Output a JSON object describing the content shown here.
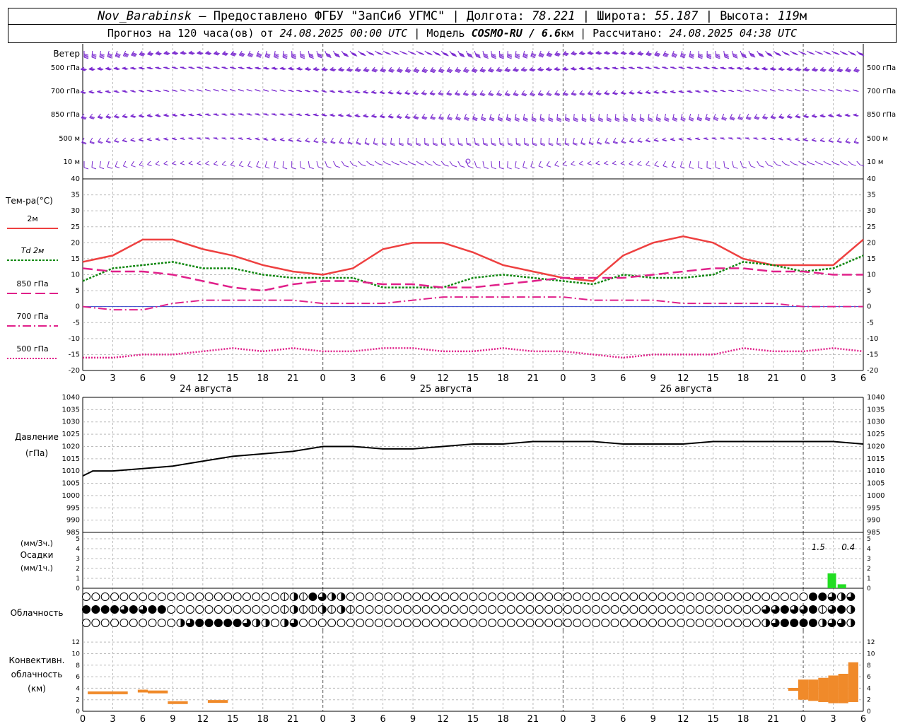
{
  "header": {
    "station": "Nov_Barabinsk",
    "provider": " — Предоставлено ФГБУ \"ЗапСиб УГМС\" | ",
    "lon_label": "Долгота: ",
    "lon": "78.221",
    "lat_label": " | Широта: ",
    "lat": "55.187",
    "alt_label": " | Высота: ",
    "alt": "119",
    "alt_unit": "м",
    "forecast_label": "Прогноз на 120 часа(ов) от ",
    "forecast_from": "24.08.2025 00:00 UTC",
    "model_label": " | Модель ",
    "model": "COSMO-RU / 6.6",
    "model_unit": "км",
    "computed_label": " | Рассчитано: ",
    "computed": "24.08.2025 04:38 UTC"
  },
  "axis": {
    "hour_ticks": [
      "0",
      "3",
      "6",
      "9",
      "12",
      "15",
      "18",
      "21",
      "0",
      "3",
      "6",
      "9",
      "12",
      "15",
      "18",
      "21",
      "0",
      "3",
      "6",
      "9",
      "12",
      "15",
      "18",
      "21",
      "0",
      "3",
      "6"
    ],
    "days": [
      "24 августа",
      "25 августа",
      "26 августа"
    ]
  },
  "wind": {
    "title": "Ветер",
    "levels": [
      "500 гПа",
      "700 гПа",
      "850 гПа",
      "500 м",
      "10  м"
    ]
  },
  "temperature": {
    "title": "Тем-ра(°С)",
    "legend": [
      {
        "label": "2м",
        "color": "#ee4040",
        "dash": "solid"
      },
      {
        "label": "Td 2м",
        "color": "#118811",
        "dash": "dot"
      },
      {
        "label": "850 гПа",
        "color": "#e0208a",
        "dash": "long"
      },
      {
        "label": "700 гПа",
        "color": "#e0208a",
        "dash": "dashdot"
      },
      {
        "label": "500 гПа",
        "color": "#e0208a",
        "dash": "fine"
      }
    ],
    "ticks": [
      "40",
      "35",
      "30",
      "25",
      "20",
      "15",
      "10",
      "5",
      "0",
      "-5",
      "-10",
      "-15",
      "-20"
    ]
  },
  "pressure": {
    "title": "Давление",
    "unit": "(гПа)",
    "ticks": [
      "1040",
      "1035",
      "1030",
      "1025",
      "1020",
      "1015",
      "1010",
      "1005",
      "1000",
      "995",
      "990",
      "985"
    ]
  },
  "precip": {
    "title": "Осадки",
    "unit3": "(мм/3ч.)",
    "unit1": "(мм/1ч.)",
    "ticks": [
      "5",
      "4",
      "3",
      "2",
      "1",
      "0"
    ],
    "labels": [
      "1.5",
      "0.4"
    ]
  },
  "clouds": {
    "title": "Облачность"
  },
  "convective": {
    "title1": "Конвективн.",
    "title2": "облачность",
    "unit": "(км)",
    "ticks": [
      "12",
      "10",
      "8",
      "6",
      "4",
      "2",
      "0"
    ]
  },
  "chart_data": [
    {
      "type": "line",
      "title": "Тем-ра(°С)",
      "x_unit": "hours from 24.08.2025 00:00 UTC",
      "x": [
        0,
        3,
        6,
        9,
        12,
        15,
        18,
        21,
        24,
        27,
        30,
        33,
        36,
        39,
        42,
        45,
        48,
        51,
        54,
        57,
        60,
        63,
        66,
        69,
        72,
        75,
        78
      ],
      "ylim": [
        -20,
        40
      ],
      "series": [
        {
          "name": "2м",
          "color": "#ee4040",
          "values": [
            14,
            16,
            21,
            21,
            18,
            16,
            13,
            11,
            10,
            12,
            18,
            20,
            20,
            17,
            13,
            11,
            9,
            8,
            16,
            20,
            22,
            20,
            15,
            13,
            13,
            13,
            21
          ]
        },
        {
          "name": "Td 2м",
          "color": "#118811",
          "values": [
            8,
            12,
            13,
            14,
            12,
            12,
            10,
            9,
            9,
            9,
            6,
            6,
            6,
            9,
            10,
            9,
            8,
            7,
            10,
            9,
            9,
            10,
            14,
            13,
            11,
            12,
            16
          ]
        },
        {
          "name": "850 гПа",
          "color": "#e0208a",
          "values": [
            12,
            11,
            11,
            10,
            8,
            6,
            5,
            7,
            8,
            8,
            7,
            7,
            6,
            6,
            7,
            8,
            9,
            9,
            9,
            10,
            11,
            12,
            12,
            11,
            11,
            10,
            10
          ]
        },
        {
          "name": "700 гПа",
          "color": "#e0208a",
          "values": [
            0,
            -1,
            -1,
            1,
            2,
            2,
            2,
            2,
            1,
            1,
            1,
            2,
            3,
            3,
            3,
            3,
            3,
            2,
            2,
            2,
            1,
            1,
            1,
            1,
            0,
            0,
            0
          ]
        },
        {
          "name": "500 гПа",
          "color": "#e0208a",
          "values": [
            -16,
            -16,
            -15,
            -15,
            -14,
            -13,
            -14,
            -13,
            -14,
            -14,
            -13,
            -13,
            -14,
            -14,
            -13,
            -14,
            -14,
            -15,
            -16,
            -15,
            -15,
            -15,
            -13,
            -14,
            -14,
            -13,
            -14
          ]
        }
      ]
    },
    {
      "type": "line",
      "title": "Давление",
      "x": [
        0,
        1,
        3,
        6,
        9,
        12,
        15,
        18,
        21,
        24,
        27,
        30,
        33,
        36,
        39,
        42,
        45,
        48,
        51,
        54,
        57,
        60,
        63,
        66,
        69,
        72,
        75,
        78
      ],
      "ylim": [
        985,
        1040
      ],
      "series": [
        {
          "name": "",
          "color": "#000000",
          "values": [
            1008,
            1010,
            1010,
            1011,
            1012,
            1014,
            1016,
            1017,
            1018,
            1020,
            1020,
            1019,
            1019,
            1020,
            1021,
            1021,
            1022,
            1022,
            1022,
            1021,
            1021,
            1021,
            1022,
            1022,
            1022,
            1022,
            1022,
            1021
          ]
        }
      ]
    },
    {
      "type": "bar",
      "title": "Осадки",
      "x": [
        75,
        76
      ],
      "values": [
        1.5,
        0.4
      ],
      "color": "#22dd22",
      "ylim": [
        0,
        5
      ]
    },
    {
      "type": "bar",
      "title": "Конвективн. облачность",
      "unit": "км",
      "color": "#f08a2a",
      "ylim": [
        0,
        13
      ],
      "segments": [
        {
          "x0": 0.5,
          "x1": 4.5,
          "bottom": 3.2,
          "top": 3.2
        },
        {
          "x0": 5.5,
          "x1": 6.5,
          "bottom": 3.5,
          "top": 3.5
        },
        {
          "x0": 6.5,
          "x1": 8.5,
          "bottom": 3.2,
          "top": 3.6
        },
        {
          "x0": 8.5,
          "x1": 10.5,
          "bottom": 1.5,
          "top": 1.5
        },
        {
          "x0": 12.5,
          "x1": 14.5,
          "bottom": 1.7,
          "top": 1.7
        },
        {
          "x0": 70.5,
          "x1": 71.5,
          "bottom": 3.8,
          "top": 3.8
        },
        {
          "x0": 71.5,
          "x1": 72.5,
          "bottom": 2.0,
          "top": 5.5
        },
        {
          "x0": 72.5,
          "x1": 73.5,
          "bottom": 1.8,
          "top": 5.5
        },
        {
          "x0": 73.5,
          "x1": 74.5,
          "bottom": 1.6,
          "top": 5.8
        },
        {
          "x0": 74.5,
          "x1": 75.5,
          "bottom": 1.4,
          "top": 6.2
        },
        {
          "x0": 75.5,
          "x1": 76.5,
          "bottom": 1.4,
          "top": 6.5
        },
        {
          "x0": 76.5,
          "x1": 77.5,
          "bottom": 1.6,
          "top": 8.5
        }
      ]
    }
  ],
  "cloud_rows": {
    "row1": "0000000000000000000001214322000000000000000000000000000000000000000000000000044323",
    "row2": "4444343440000000000001211212100000000000000000000000000000000000000000003343341342",
    "row3": "0000000000234444432202300000000000000000000000000000000000000000000000002344442332"
  }
}
